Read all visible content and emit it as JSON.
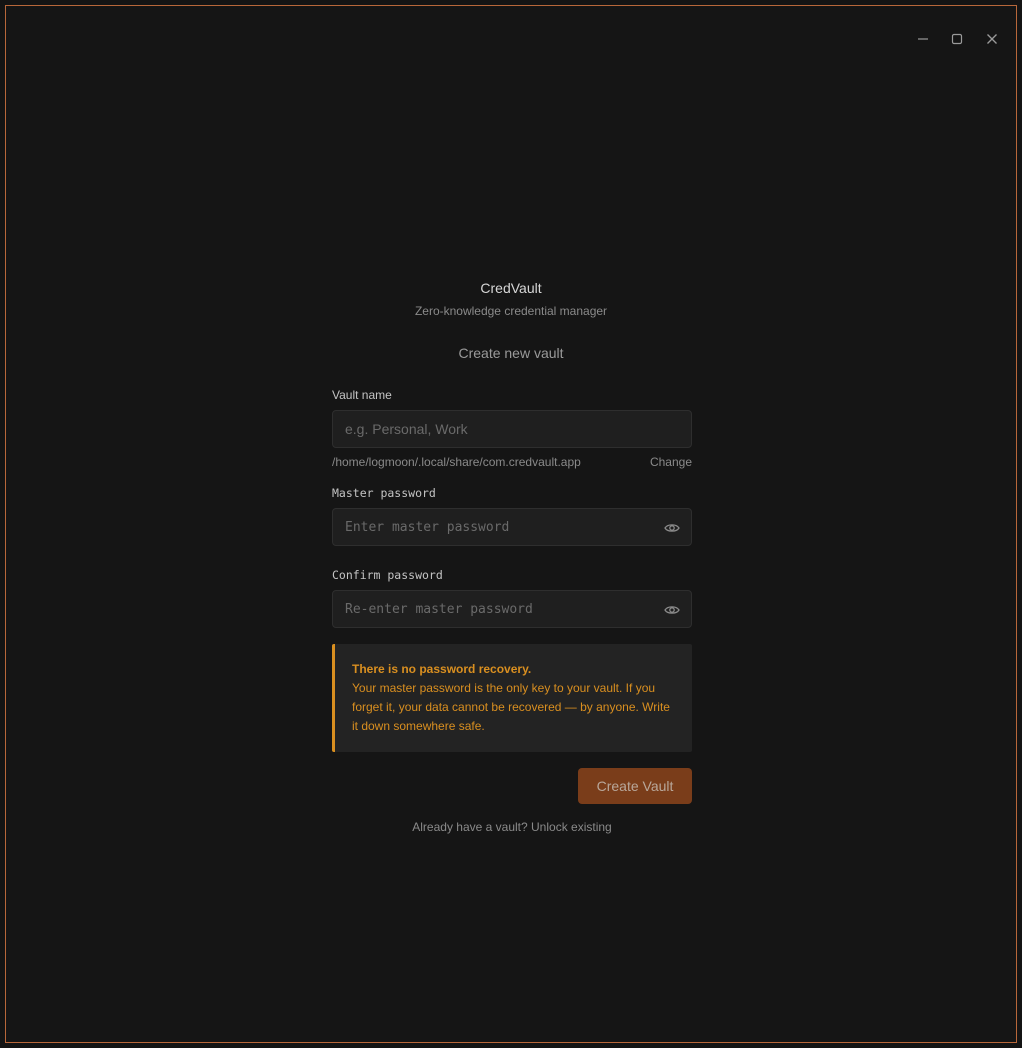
{
  "app": {
    "title": "CredVault",
    "subtitle": "Zero-knowledge credential manager"
  },
  "form": {
    "heading": "Create new vault",
    "vault_name": {
      "label": "Vault name",
      "value": "",
      "placeholder": "e.g. Personal, Work"
    },
    "path": {
      "value": "/home/logmoon/.local/share/com.credvault.app",
      "change_label": "Change"
    },
    "master_password": {
      "label": "Master password",
      "value": "",
      "placeholder": "Enter master password"
    },
    "confirm_password": {
      "label": "Confirm password",
      "value": "",
      "placeholder": "Re-enter master password"
    },
    "warning": {
      "title": "There is no password recovery.",
      "body": "Your master password is the only key to your vault. If you forget it, your data cannot be recovered — by anyone. Write it down somewhere safe."
    },
    "submit_label": "Create Vault"
  },
  "footer": {
    "prompt": "Already have a vault?",
    "link_label": "Unlock existing"
  },
  "icons": {
    "minimize": "minimize-icon",
    "maximize": "maximize-icon",
    "close": "close-icon",
    "show_password": "eye-icon"
  },
  "colors": {
    "accent": "#d98f20",
    "window_border": "#b8673a",
    "primary_button": "#7a3d1a",
    "background": "#151515"
  }
}
